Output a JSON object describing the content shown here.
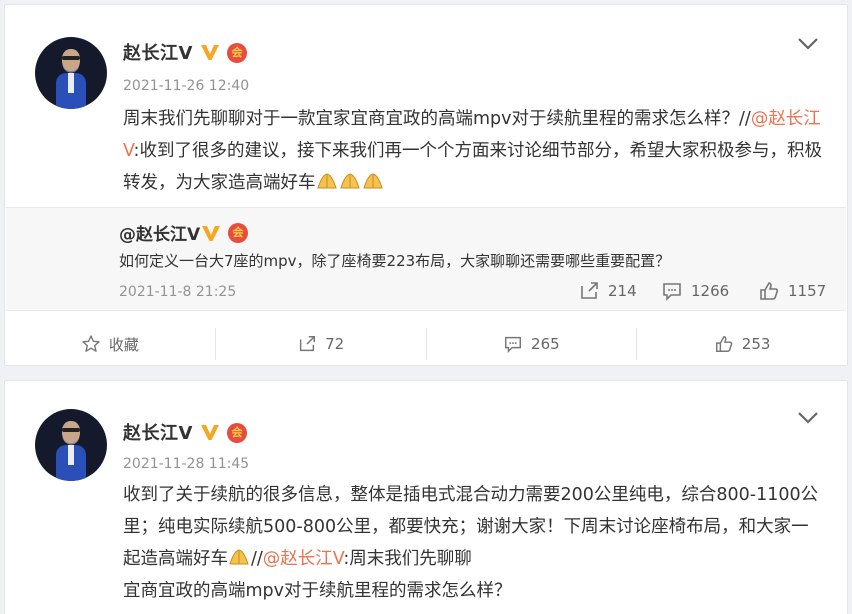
{
  "posts": [
    {
      "user": "赵长江V",
      "medal": "会",
      "time": "2021-11-26 12:40",
      "text": {
        "part1": "周末我们先聊聊对于一款宜家宜商宜政的高端mpv对于续航里程的需求怎么样？//",
        "mention": "@赵长江V",
        "part2": ":收到了很多的建议，接下来我们再一个个方面来讨论细节部分，希望大家积极参与，积极转发，为大家造高端好车"
      },
      "quote": {
        "user": "@赵长江V",
        "text": "如何定义一台大7座的mpv，除了座椅要223布局，大家聊聊还需要哪些重要配置？",
        "time": "2021-11-8 21:25",
        "reposts": "214",
        "comments": "1266",
        "likes": "1157"
      },
      "actions": {
        "favorite": "收藏",
        "reposts": "72",
        "comments": "265",
        "likes": "253"
      }
    },
    {
      "user": "赵长江V",
      "medal": "会",
      "time": "2021-11-28 11:45",
      "text": {
        "part1": "收到了关于续航的很多信息，整体是插电式混合动力需要200公里纯电，综合800-1100公里；纯电实际续航500-800公里，都要快充；谢谢大家！下周末讨论座椅布局，和大家一起造高端好车",
        "part2": "//",
        "mention": "@赵长江V",
        "part3": ":周末我们先聊聊",
        "part4": "宜商宜政的高端mpv对于续航里程的需求怎么样？"
      }
    }
  ],
  "icons": [
    "verified-v-icon",
    "member-medal-icon",
    "chevron-down-icon",
    "pray-hands-emoji",
    "repost-icon",
    "comment-icon",
    "like-icon",
    "star-icon"
  ],
  "colors": {
    "mention": "#eb7350",
    "verified": "#f5a623",
    "time": "#939393"
  }
}
